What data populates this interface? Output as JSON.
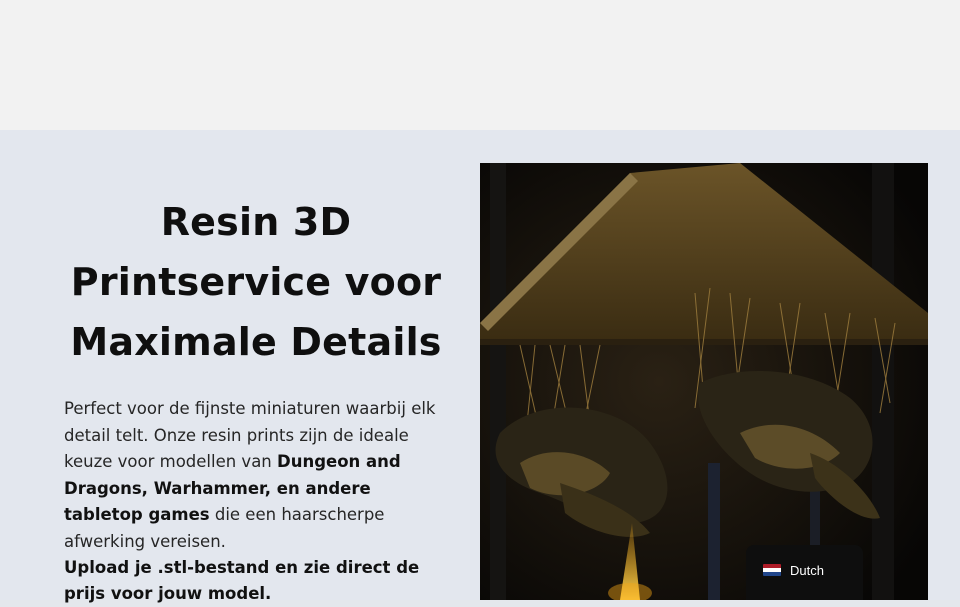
{
  "hero": {
    "title": "Resin 3D Printservice voor Maximale Details",
    "text_intro": "Perfect voor de fijnste miniaturen waarbij elk detail telt. Onze resin prints zijn de ideale keuze voor modellen van ",
    "text_bold": "Dungeon and Dragons, Warhammer, en andere tabletop games",
    "text_outro": " die een haarscherpe afwerking vereisen.",
    "cta_text": "Upload je .stl-bestand en zie direct de prijs voor jouw model."
  },
  "photo": {
    "icon": "resin-printer-photo",
    "colors": {
      "glow": "#f2a516",
      "resin": "#9a7a3c",
      "dark": "#0b0a08"
    }
  },
  "language_switcher": {
    "label": "Dutch",
    "flag_icon": "netherlands-flag-icon",
    "flag_colors": [
      "#ae1c28",
      "#ffffff",
      "#21468b"
    ]
  }
}
